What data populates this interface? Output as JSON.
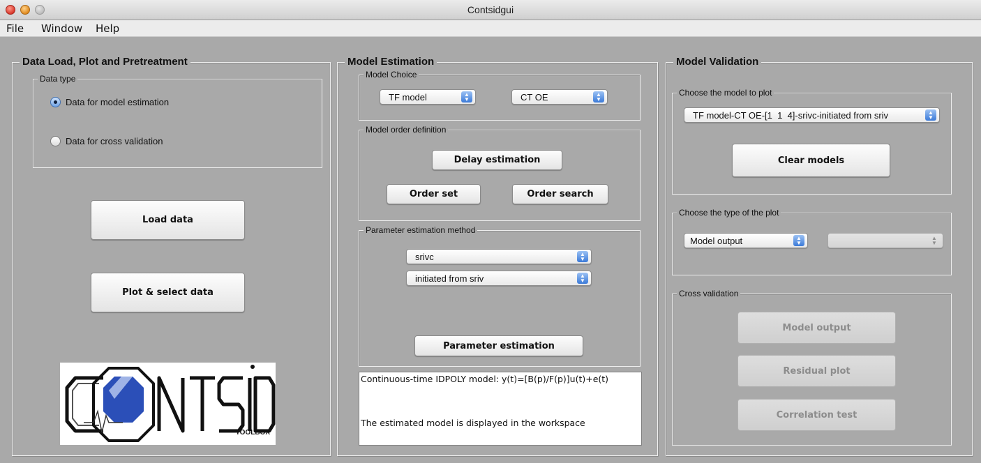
{
  "window": {
    "title": "Contsidgui"
  },
  "menu": [
    "File",
    "Window",
    "Help"
  ],
  "data_panel": {
    "title": "Data Load, Plot and Pretreatment",
    "data_type": {
      "title": "Data type",
      "options": [
        "Data for model estimation",
        "Data for cross validation"
      ],
      "selected": "Data for model estimation"
    },
    "load_button": "Load data",
    "plot_button": "Plot & select data",
    "logo": {
      "text": "CONTSID",
      "subtext": "TOOLBOX"
    }
  },
  "estimation_panel": {
    "title": "Model Estimation",
    "model_choice": {
      "title": "Model Choice",
      "model_type": "TF model",
      "model_structure": "CT OE"
    },
    "order_def": {
      "title": "Model order definition",
      "delay_button": "Delay estimation",
      "order_set_button": "Order set",
      "order_search_button": "Order search"
    },
    "param_method": {
      "title": "Parameter estimation method",
      "method": "srivc",
      "init": "initiated from sriv",
      "estimate_button": "Parameter estimation"
    },
    "output": {
      "line1": "Continuous-time IDPOLY model: y(t)=[B(p)/F(p)]u(t)+e(t)",
      "line2": "The estimated model is displayed in the workspace"
    }
  },
  "validation_panel": {
    "title": "Model Validation",
    "plot_model": {
      "title": "Choose the model to plot",
      "selected": "TF model-CT OE-[1  1  4]-srivc-initiated from sriv",
      "clear_button": "Clear models"
    },
    "plot_type": {
      "title": "Choose the type of the plot",
      "selected": "Model output",
      "secondary": ""
    },
    "cross_validation": {
      "title": "Cross validation",
      "model_output_button": "Model output",
      "residual_button": "Residual plot",
      "correlation_button": "Correlation test"
    }
  },
  "colors": {
    "background": "#a9a9a9",
    "accent": "#3b7ad8",
    "logo_blue": "#2b4fb8"
  }
}
